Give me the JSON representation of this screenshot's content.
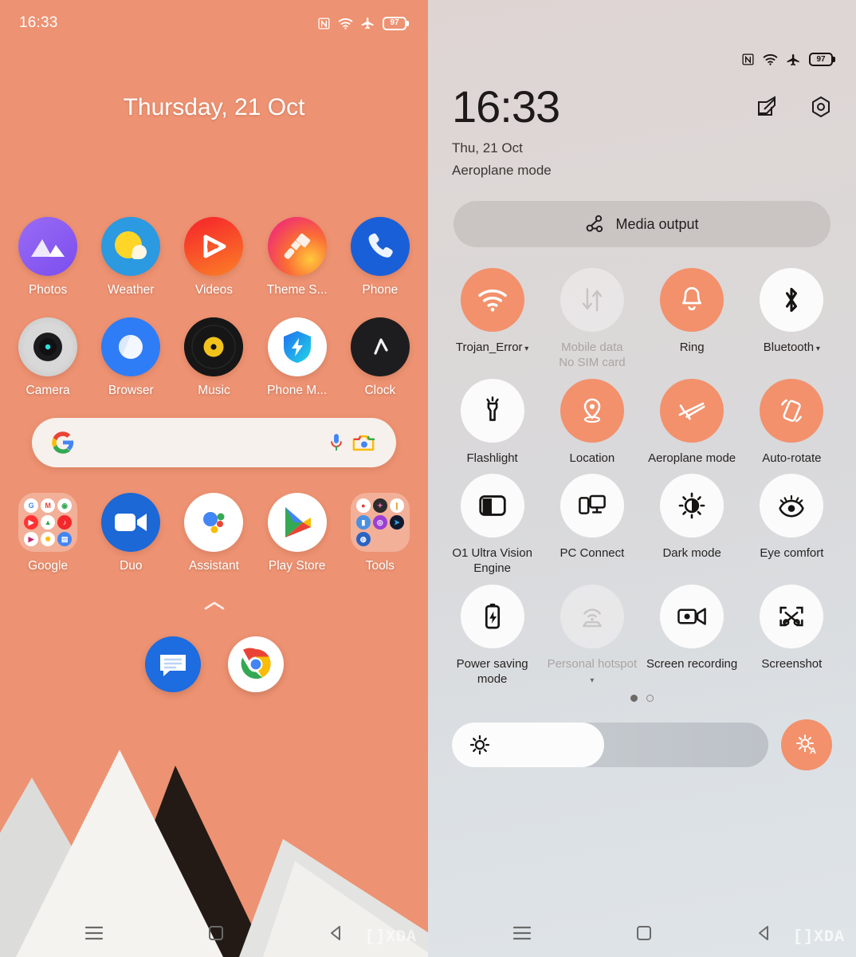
{
  "home": {
    "status_bar": {
      "time": "16:33",
      "icons": [
        "nfc-icon",
        "wifi-icon",
        "airplane-icon",
        "battery-icon"
      ],
      "battery_level": "97"
    },
    "date_widget": "Thursday, 21 Oct",
    "app_rows": [
      [
        {
          "label": "Photos",
          "icon": "photos-icon"
        },
        {
          "label": "Weather",
          "icon": "weather-icon"
        },
        {
          "label": "Videos",
          "icon": "videos-icon"
        },
        {
          "label": "Theme S...",
          "icon": "theme-store-icon"
        },
        {
          "label": "Phone",
          "icon": "phone-icon"
        }
      ],
      [
        {
          "label": "Camera",
          "icon": "camera-icon"
        },
        {
          "label": "Browser",
          "icon": "browser-icon"
        },
        {
          "label": "Music",
          "icon": "music-icon"
        },
        {
          "label": "Phone M...",
          "icon": "phone-manager-icon"
        },
        {
          "label": "Clock",
          "icon": "clock-icon"
        }
      ],
      [
        {
          "label": "Google",
          "icon": "google-folder-icon"
        },
        {
          "label": "Duo",
          "icon": "duo-icon"
        },
        {
          "label": "Assistant",
          "icon": "assistant-icon"
        },
        {
          "label": "Play Store",
          "icon": "play-store-icon"
        },
        {
          "label": "Tools",
          "icon": "tools-folder-icon"
        }
      ]
    ],
    "search": {
      "value": "",
      "placeholder": "",
      "logo": "google-g-icon",
      "mic": "microphone-icon",
      "lens": "google-lens-icon"
    },
    "app_drawer_handle": "chevron-up-icon",
    "dock": [
      {
        "label": "Messages",
        "icon": "messages-icon"
      },
      {
        "label": "Chrome",
        "icon": "chrome-icon"
      }
    ],
    "nav_bar": [
      {
        "label": "Recents",
        "icon": "recents-icon"
      },
      {
        "label": "Home",
        "icon": "home-icon"
      },
      {
        "label": "Back",
        "icon": "back-icon"
      }
    ],
    "watermark": "[]XDA"
  },
  "quick_settings": {
    "status_bar": {
      "icons": [
        "nfc-icon",
        "wifi-icon",
        "airplane-icon",
        "battery-icon"
      ],
      "battery_level": "97"
    },
    "clock": "16:33",
    "date": "Thu, 21 Oct",
    "subtitle": "Aeroplane mode",
    "header_icons": [
      {
        "name": "edit-icon"
      },
      {
        "name": "settings-icon"
      }
    ],
    "media_output": {
      "label": "Media output",
      "icon": "media-cast-icon"
    },
    "tile_rows": [
      [
        {
          "label": "Trojan_Error",
          "sublabel": "",
          "icon": "wifi-tile-icon",
          "state": "on",
          "caret": true
        },
        {
          "label": "Mobile data",
          "sublabel": "No SIM card",
          "icon": "mobile-data-icon",
          "state": "disabled",
          "caret": false
        },
        {
          "label": "Ring",
          "sublabel": "",
          "icon": "ring-bell-icon",
          "state": "on",
          "caret": false
        },
        {
          "label": "Bluetooth",
          "sublabel": "",
          "icon": "bluetooth-icon",
          "state": "off",
          "caret": true
        }
      ],
      [
        {
          "label": "Flashlight",
          "sublabel": "",
          "icon": "flashlight-icon",
          "state": "off",
          "caret": false
        },
        {
          "label": "Location",
          "sublabel": "",
          "icon": "location-pin-icon",
          "state": "on",
          "caret": false
        },
        {
          "label": "Aeroplane mode",
          "sublabel": "",
          "icon": "airplane-tile-icon",
          "state": "on",
          "caret": false
        },
        {
          "label": "Auto-rotate",
          "sublabel": "",
          "icon": "auto-rotate-icon",
          "state": "on",
          "caret": false
        }
      ],
      [
        {
          "label": "O1 Ultra Vision Engine",
          "sublabel": "",
          "icon": "vision-engine-icon",
          "state": "off",
          "caret": false
        },
        {
          "label": "PC Connect",
          "sublabel": "",
          "icon": "pc-connect-icon",
          "state": "off",
          "caret": false
        },
        {
          "label": "Dark mode",
          "sublabel": "",
          "icon": "dark-mode-icon",
          "state": "off",
          "caret": false
        },
        {
          "label": "Eye comfort",
          "sublabel": "",
          "icon": "eye-comfort-icon",
          "state": "off",
          "caret": false
        }
      ],
      [
        {
          "label": "Power saving mode",
          "sublabel": "",
          "icon": "battery-saver-icon",
          "state": "off",
          "caret": false
        },
        {
          "label": "Personal hotspot",
          "sublabel": "",
          "icon": "hotspot-icon",
          "state": "disabled",
          "caret": true
        },
        {
          "label": "Screen recording",
          "sublabel": "",
          "icon": "screen-record-icon",
          "state": "off",
          "caret": false
        },
        {
          "label": "Screenshot",
          "sublabel": "",
          "icon": "screenshot-icon",
          "state": "off",
          "caret": false
        }
      ]
    ],
    "page_indicator": {
      "current": 1,
      "total": 2
    },
    "brightness": {
      "value_percent": 48,
      "icon": "brightness-icon",
      "auto_icon": "auto-brightness-icon"
    },
    "nav_bar": [
      {
        "label": "Recents",
        "icon": "recents-icon"
      },
      {
        "label": "Home",
        "icon": "home-icon"
      },
      {
        "label": "Back",
        "icon": "back-icon"
      }
    ],
    "watermark": "[]XDA"
  },
  "colors": {
    "home_bg": "#ed9272",
    "accent_on": "#f2916c",
    "tile_off": "#fbfbfb",
    "qs_bg_top": "#ded5d3",
    "qs_bg_bottom": "#dfe4e8"
  }
}
